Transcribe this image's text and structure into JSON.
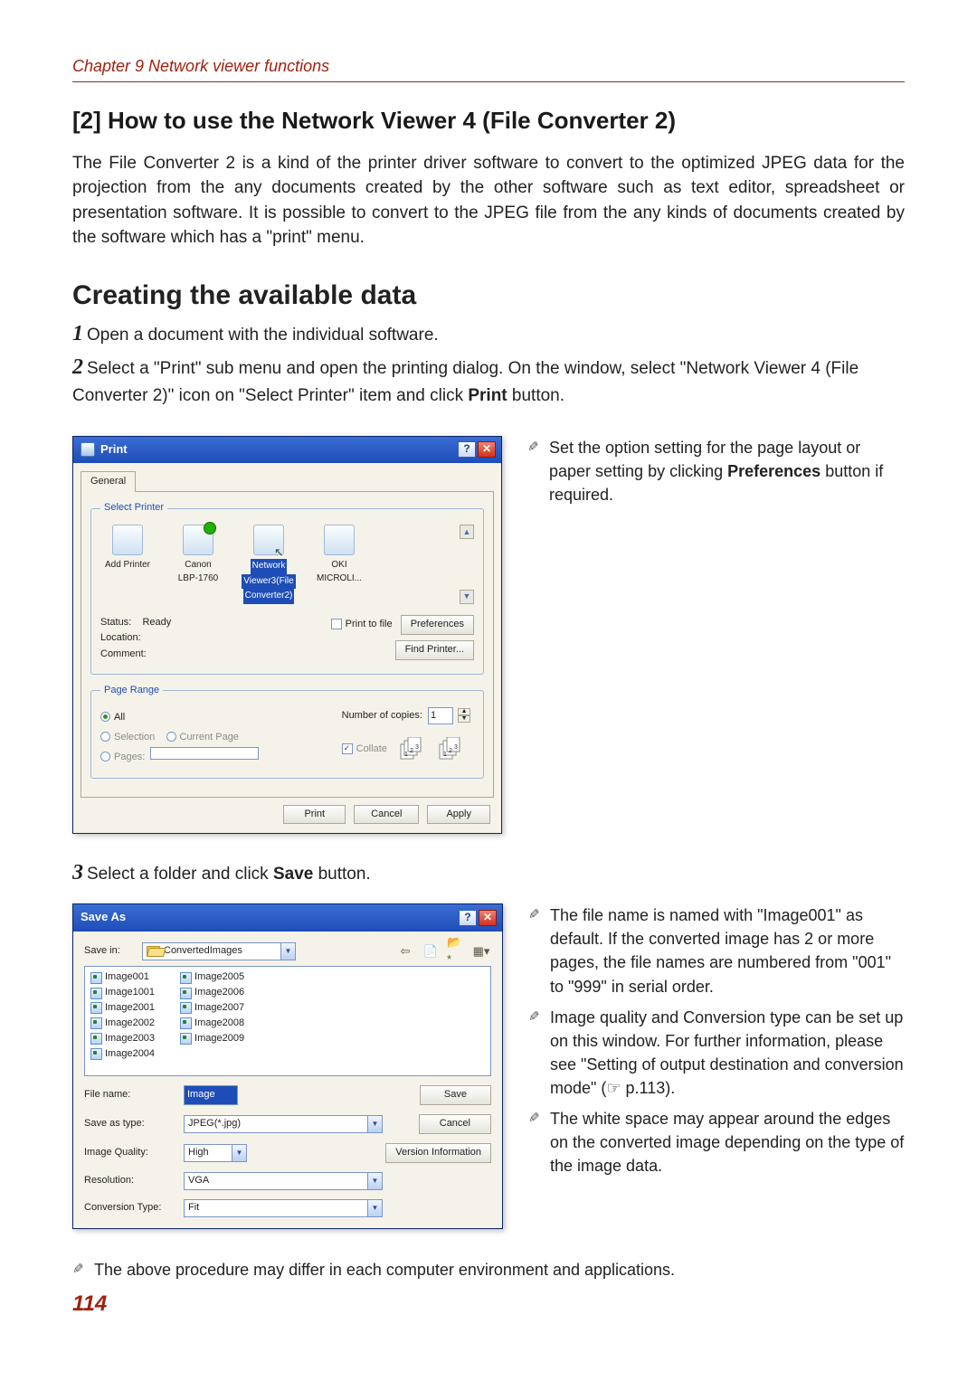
{
  "chapter_line": "Chapter 9 Network viewer functions",
  "section_title": "[2] How to use the Network Viewer 4 (File Converter 2)",
  "intro_paragraph": "The File Converter 2 is a kind of the printer driver software to convert to the optimized JPEG data for the projection from the any documents created by the other software such as text editor, spreadsheet or presentation software. It is possible to convert to the JPEG file from the any kinds of documents created by the software which has a \"print\" menu.",
  "sub_title": "Creating the available data",
  "steps": {
    "s1": "Open a document with the individual software.",
    "s2a": "Select a \"Print\" sub menu and open the printing dialog. On the window, select \"Network Viewer 4 (File Converter 2)\" icon on \"Select Printer\" item and click ",
    "s2b": "Print",
    "s2c": " button.",
    "s3a": "Select a folder and click ",
    "s3b": "Save",
    "s3c": " button."
  },
  "print_dlg": {
    "title": "Print",
    "help": "?",
    "tab_general": "General",
    "group_select_printer": "Select Printer",
    "printers": {
      "p1": "Add Printer",
      "p2a": "Canon",
      "p2b": "LBP-1760",
      "p3a": "Network",
      "p3b": "Viewer3(File",
      "p3c": "Converter2)",
      "p4a": "OKI",
      "p4b": "MICROLI..."
    },
    "status_label": "Status:",
    "status_value": "Ready",
    "location_label": "Location:",
    "comment_label": "Comment:",
    "print_to_file": "Print to file",
    "btn_prefs": "Preferences",
    "btn_find": "Find Printer...",
    "group_page_range": "Page Range",
    "range_all": "All",
    "range_sel": "Selection",
    "range_cur": "Current Page",
    "range_pages": "Pages:",
    "copies_label": "Number of copies:",
    "copies_value": "1",
    "collate": "Collate",
    "btn_print": "Print",
    "btn_cancel": "Cancel",
    "btn_apply": "Apply"
  },
  "right_tip1a": "Set the option setting for the page layout or paper setting by clicking ",
  "right_tip1b": "Preferences",
  "right_tip1c": " button if required.",
  "saveas_dlg": {
    "title": "Save As",
    "help": "?",
    "savein_label": "Save in:",
    "savein_value": "ConvertedImages",
    "files": [
      "Image001",
      "Image1001",
      "Image2001",
      "Image2002",
      "Image2003",
      "Image2004",
      "Image2005",
      "Image2006",
      "Image2007",
      "Image2008",
      "Image2009"
    ],
    "filename_label": "File name:",
    "filename_value": "Image",
    "savetype_label": "Save as type:",
    "savetype_value": "JPEG(*.jpg)",
    "quality_label": "Image Quality:",
    "quality_value": "High",
    "resolution_label": "Resolution:",
    "resolution_value": "VGA",
    "convtype_label": "Conversion Type:",
    "convtype_value": "Fit",
    "btn_save": "Save",
    "btn_cancel": "Cancel",
    "btn_version": "Version Information"
  },
  "tips2": {
    "t1": "The file name is named with \"Image001\" as default. If the converted image has 2 or more pages, the file names are numbered from \"001\" to \"999\" in serial order.",
    "t2": "Image quality and Conversion type can be set up on this window. For further information, please see \"Setting of output destination and conversion mode\" (☞ p.113).",
    "t3": "The white space may appear around the edges on the converted image depending on the type of the image data."
  },
  "bottom_tip": "The above procedure may differ in each computer environment and applications.",
  "page_number": "114"
}
